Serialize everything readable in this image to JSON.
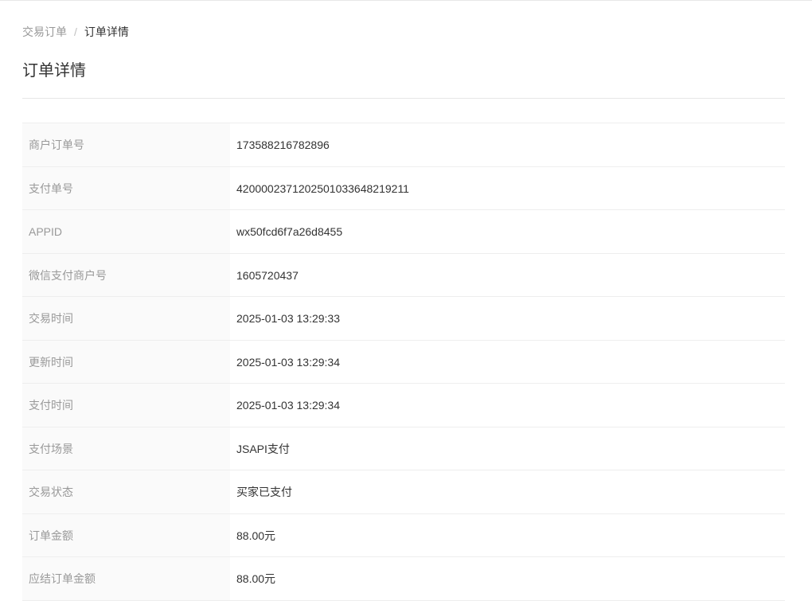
{
  "breadcrumb": {
    "parent": "交易订单",
    "separator": "/",
    "current": "订单详情"
  },
  "page_title": "订单详情",
  "details": [
    {
      "label": "商户订单号",
      "value": "173588216782896"
    },
    {
      "label": "支付单号",
      "value": "4200002371202501033648219211"
    },
    {
      "label": "APPID",
      "value": "wx50fcd6f7a26d8455"
    },
    {
      "label": "微信支付商户号",
      "value": "1605720437"
    },
    {
      "label": "交易时间",
      "value": "2025-01-03 13:29:33"
    },
    {
      "label": "更新时间",
      "value": "2025-01-03 13:29:34"
    },
    {
      "label": "支付时间",
      "value": "2025-01-03 13:29:34"
    },
    {
      "label": "支付场景",
      "value": "JSAPI支付"
    },
    {
      "label": "交易状态",
      "value": "买家已支付"
    },
    {
      "label": "订单金额",
      "value": "88.00元"
    },
    {
      "label": "应结订单金额",
      "value": "88.00元"
    }
  ]
}
